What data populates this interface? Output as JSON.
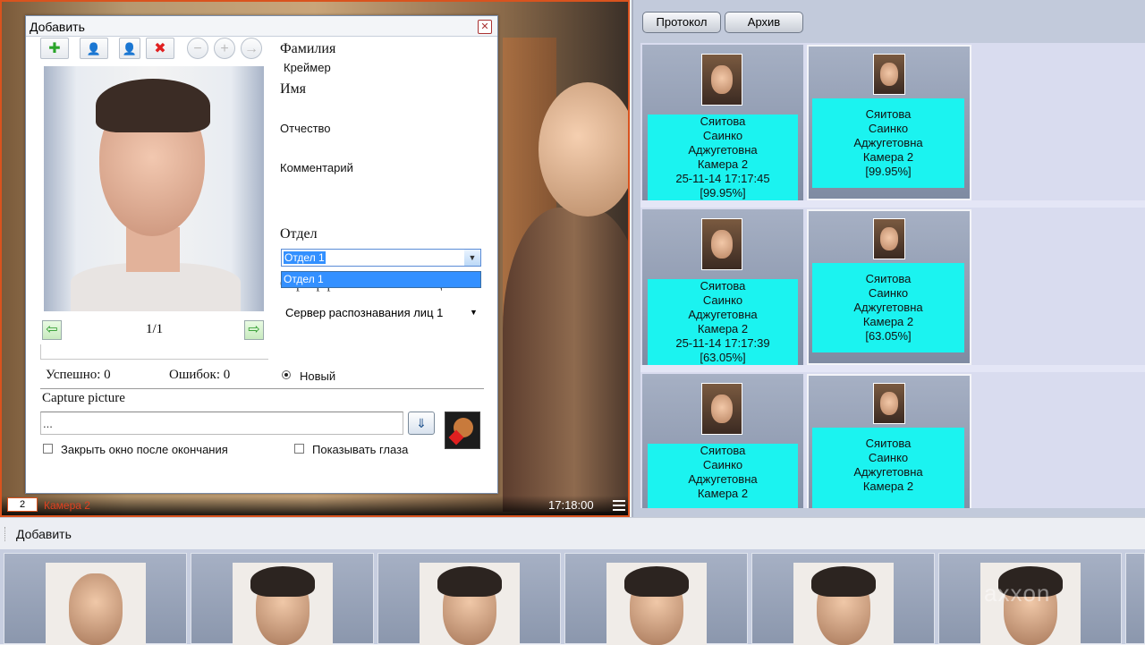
{
  "camera": {
    "number": "2",
    "name": "Камера 2",
    "time": "17:18:00"
  },
  "dialog": {
    "title": "Добавить",
    "close_glyph": "✕",
    "toolbar": [
      {
        "name": "add-button",
        "glyph": "✚"
      },
      {
        "name": "add-person-button",
        "glyph": "👤"
      },
      {
        "name": "person-edit-button",
        "glyph": "👤"
      },
      {
        "name": "delete-button",
        "glyph": "✖"
      },
      {
        "name": "minus-button",
        "glyph": "−"
      },
      {
        "name": "plus-button",
        "glyph": "+"
      },
      {
        "name": "forward-button",
        "glyph": "→"
      }
    ],
    "page": "1/1",
    "nav_prev": "⇦",
    "nav_next": "⇨",
    "labels": {
      "surname": "Фамилия",
      "surname_value": "Креймер",
      "name": "Имя",
      "patronymic": "Отчество",
      "comment": "Комментарий",
      "department": "Отдел",
      "server": "Сервер распознавания лиц"
    },
    "department_value": "Отдел 1",
    "department_options": [
      "Отдел 1"
    ],
    "server_value": "Сервер распознавания лиц 1",
    "success": "Успешно: 0",
    "errors": "Ошибок: 0",
    "radio_new": "Новый",
    "capture_label": "Capture picture",
    "capture_value": "...",
    "close_after": "Закрыть окно после окончания",
    "show_eyes": "Показывать глаза"
  },
  "protocol": {
    "buttons": [
      "Протокол",
      "Архив"
    ],
    "rows": [
      {
        "left": "Сяитова\nСаинко\nАджугетовна\nКамера 2\n25-11-14 17:17:45\n[99.95%]",
        "right": "Сяитова\nСаинко\nАджугетовна\nКамера 2\n[99.95%]"
      },
      {
        "left": "Сяитова\nСаинко\nАджугетовна\nКамера 2\n25-11-14 17:17:39\n[63.05%]",
        "right": "Сяитова\nСаинко\nАджугетовна\nКамера 2\n[63.05%]"
      },
      {
        "left": "Сяитова\nСаинко\nАджугетовна\nКамера 2",
        "right": "Сяитова\nСаинко\nАджугетовна\nКамера 2"
      }
    ]
  },
  "bottom": {
    "add_label": "Добавить",
    "watermark": "axxon"
  }
}
